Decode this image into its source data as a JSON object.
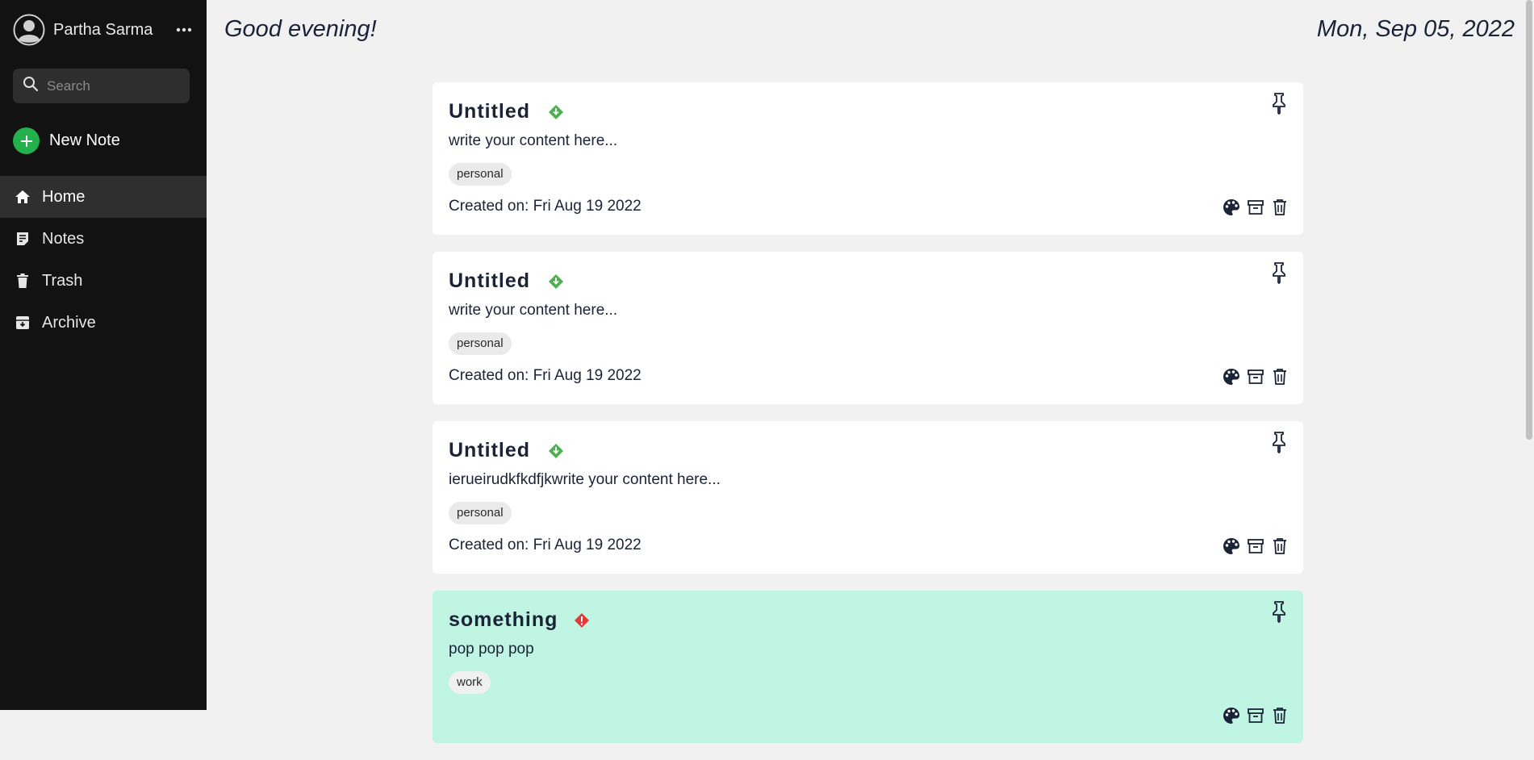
{
  "user": {
    "name": "Partha Sarma"
  },
  "search": {
    "placeholder": "Search"
  },
  "new_note": {
    "label": "New Note"
  },
  "nav": [
    {
      "label": "Home",
      "active": true,
      "icon": "home-icon"
    },
    {
      "label": "Notes",
      "active": false,
      "icon": "notes-icon"
    },
    {
      "label": "Trash",
      "active": false,
      "icon": "trash-icon"
    },
    {
      "label": "Archive",
      "active": false,
      "icon": "archive-icon"
    }
  ],
  "header": {
    "greeting": "Good evening!",
    "date": "Mon, Sep 05, 2022"
  },
  "notes": [
    {
      "title": "Untitled",
      "priority_color": "#4caf50",
      "content": "write your content here...",
      "tag": "personal",
      "created": "Created on: Fri Aug 19 2022",
      "background": "#ffffff"
    },
    {
      "title": "Untitled",
      "priority_color": "#4caf50",
      "content": "write your content here...",
      "tag": "personal",
      "created": "Created on: Fri Aug 19 2022",
      "background": "#ffffff"
    },
    {
      "title": "Untitled",
      "priority_color": "#4caf50",
      "content": "ierueirudkfkdfjkwrite your content here...",
      "tag": "personal",
      "created": "Created on: Fri Aug 19 2022",
      "background": "#ffffff"
    },
    {
      "title": "something",
      "priority_color": "#e53935",
      "content": "pop pop pop",
      "tag": "work",
      "background": "#c0f4e3"
    }
  ],
  "colors": {
    "sidebar": "#121212",
    "accent_green": "#22b14c",
    "text_dark": "#1b2338"
  }
}
